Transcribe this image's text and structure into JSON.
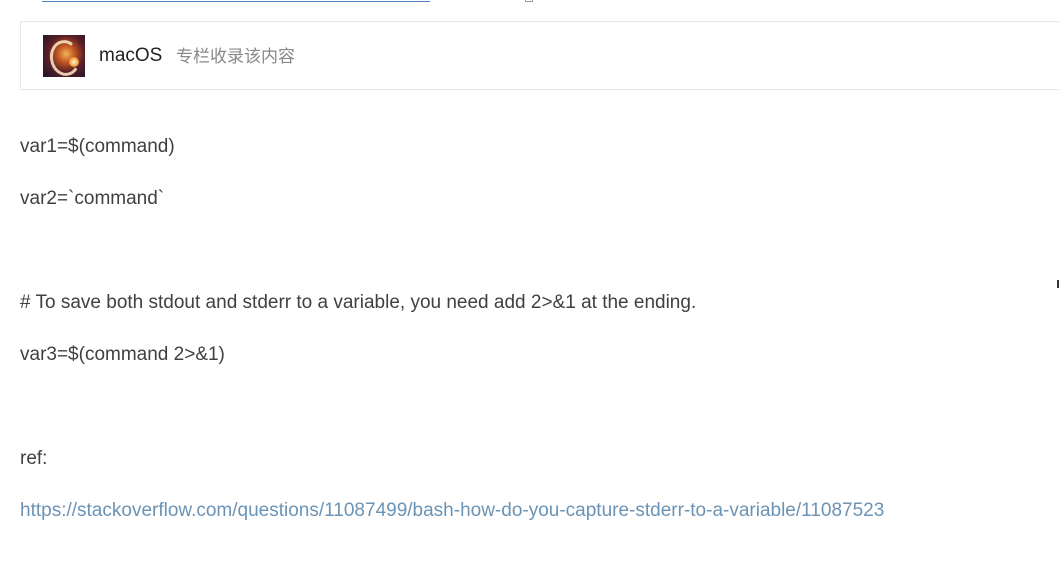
{
  "column": {
    "name": "macOS",
    "description": "专栏收录该内容"
  },
  "article": {
    "line1": "var1=$(command)",
    "line2": "var2=`command`",
    "comment": "# To save both stdout and stderr to a variable, you need add 2>&1 at the ending.",
    "line3": "var3=$(command 2>&1)",
    "ref_label": "ref:",
    "ref_url": "https://stackoverflow.com/questions/11087499/bash-how-do-you-capture-stderr-to-a-variable/11087523"
  },
  "colors": {
    "text": "#404040",
    "link": "#6b93b5",
    "muted": "#888888",
    "border": "#e8e8ea"
  }
}
